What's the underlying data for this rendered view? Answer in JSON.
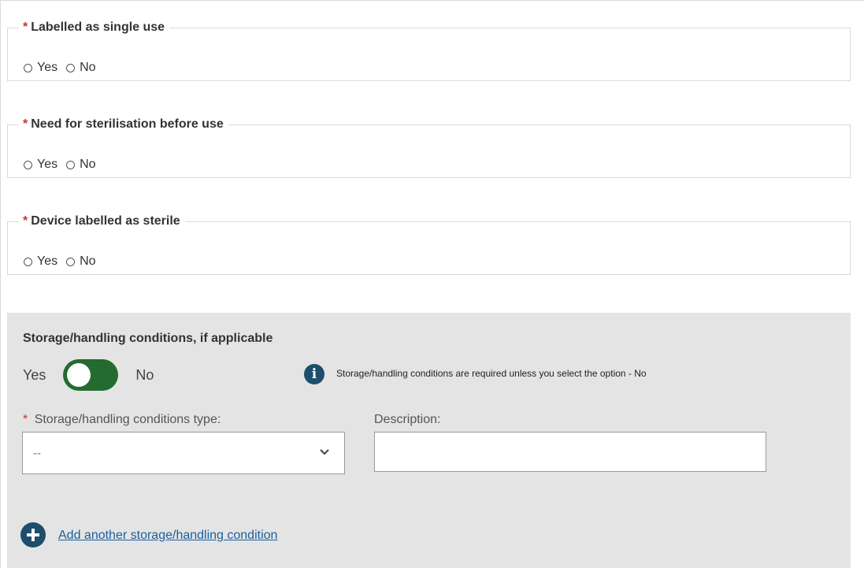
{
  "questions": [
    {
      "required_mark": "*",
      "label": "Labelled as single use",
      "options": [
        "Yes",
        "No"
      ]
    },
    {
      "required_mark": "*",
      "label": "Need for sterilisation before use",
      "options": [
        "Yes",
        "No"
      ]
    },
    {
      "required_mark": "*",
      "label": "Device labelled as sterile",
      "options": [
        "Yes",
        "No"
      ]
    }
  ],
  "storage": {
    "title": "Storage/handling conditions, if applicable",
    "toggle_yes": "Yes",
    "toggle_no": "No",
    "toggle_state": "Yes",
    "info_icon": "info-icon",
    "info_text": "Storage/handling conditions are required unless you select the option - No",
    "type_required_mark": "*",
    "type_label": "Storage/handling conditions type:",
    "type_value": "--",
    "description_label": "Description:",
    "description_value": "",
    "add_icon": "plus-circle-icon",
    "add_link": "Add another storage/handling condition"
  },
  "colors": {
    "required": "#c0392b",
    "toggle_on": "#236b2f",
    "icon_bg": "#1d4e6b",
    "link": "#1a5f9e",
    "panel_bg": "#e4e4e4"
  }
}
